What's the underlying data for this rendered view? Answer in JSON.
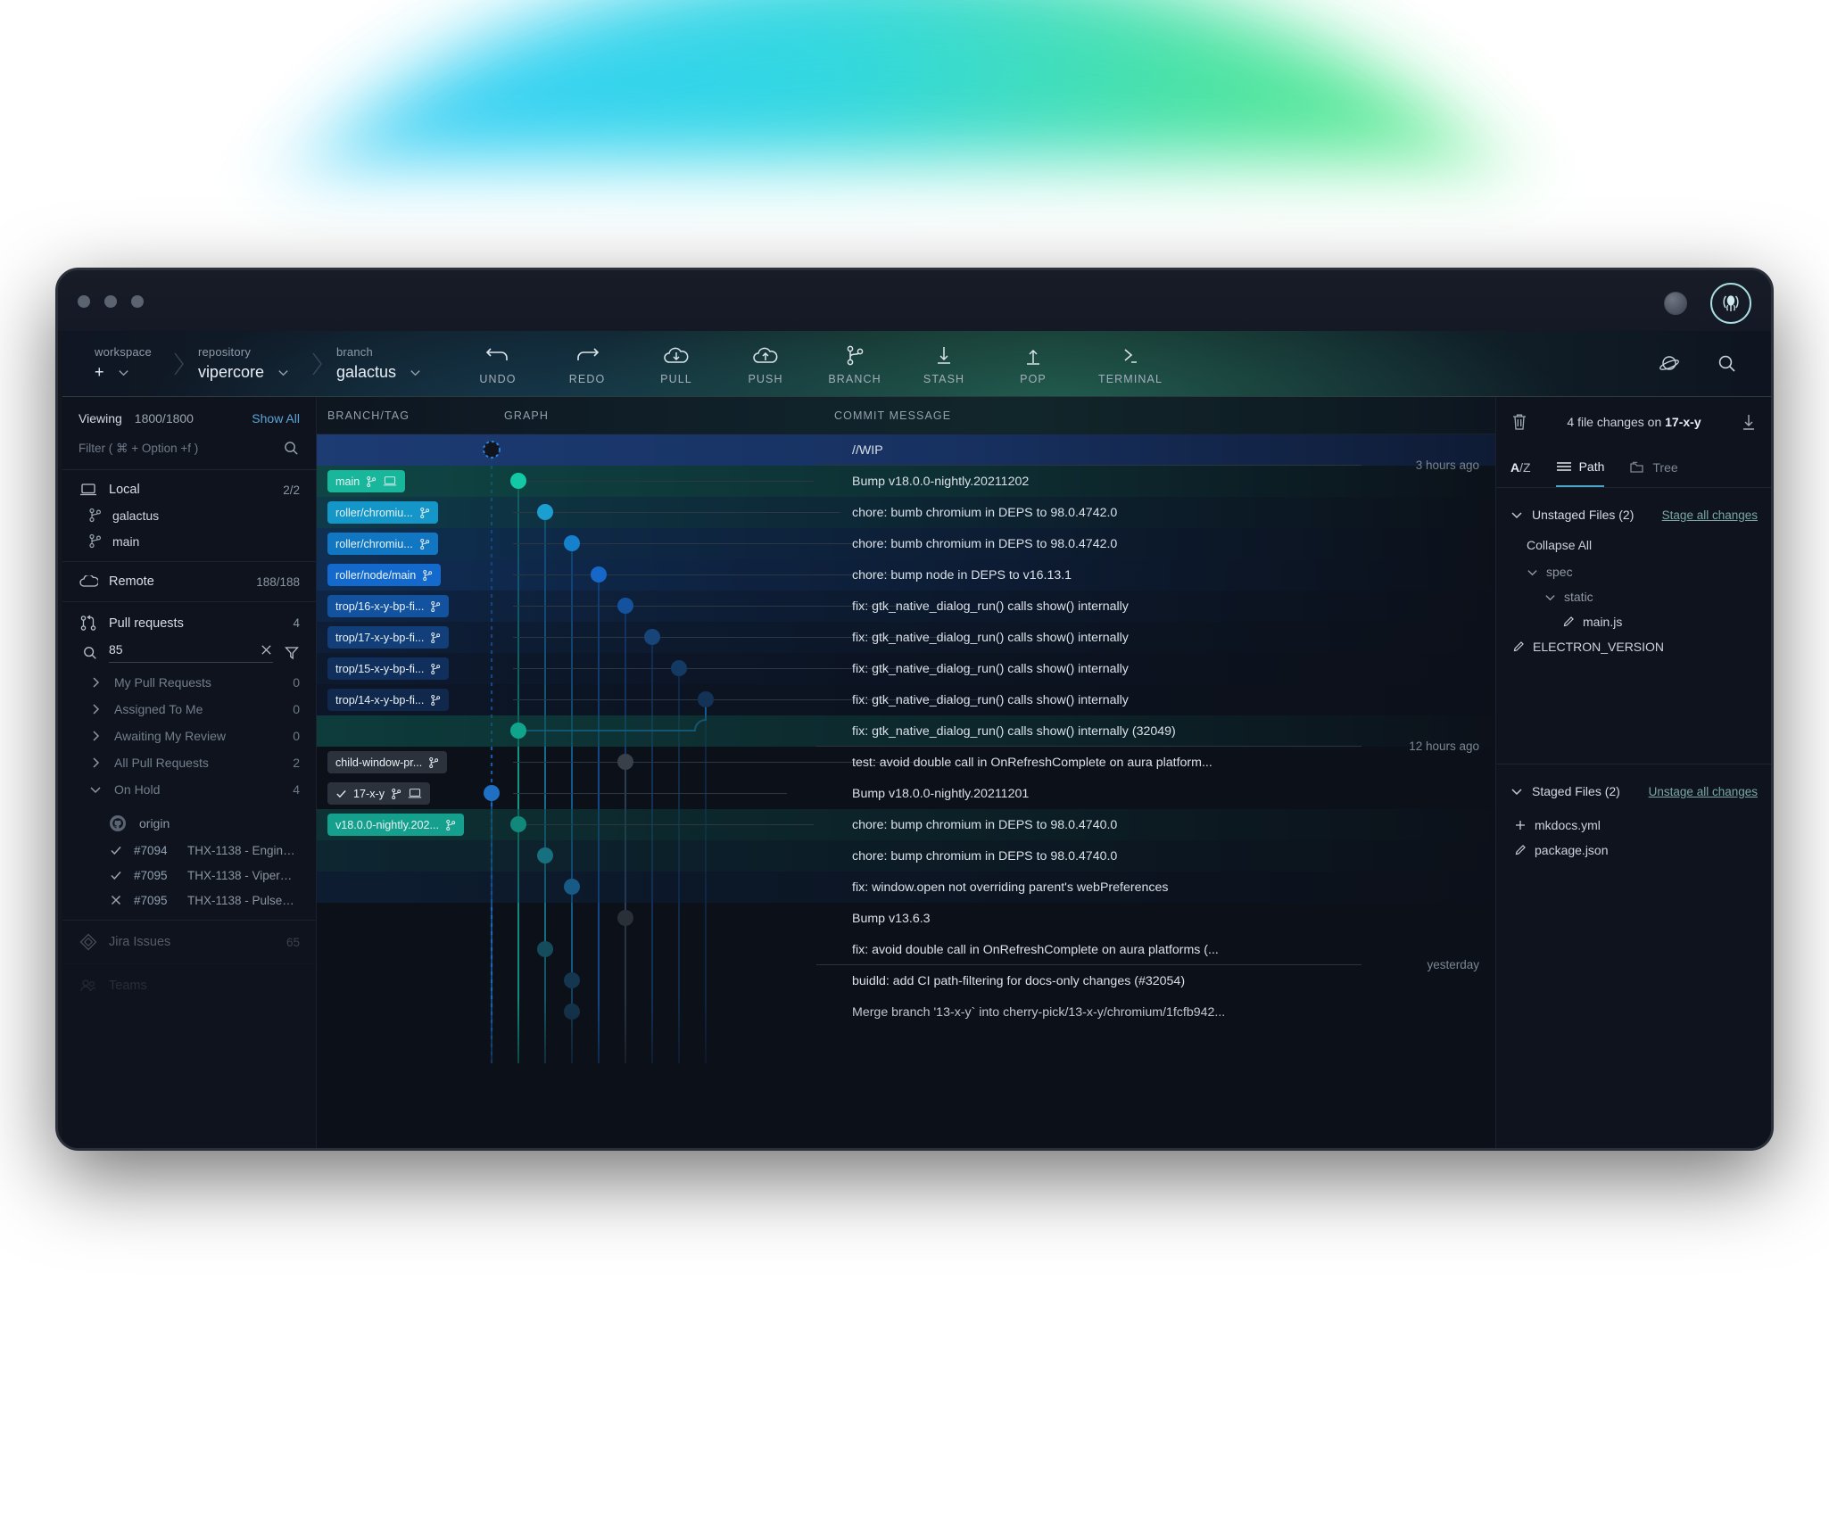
{
  "window": {
    "traffic_lights": [
      "close",
      "minimize",
      "maximize"
    ],
    "logo": "gitkraken-squid-logo"
  },
  "toolbar": {
    "crumbs": [
      {
        "label": "workspace",
        "value": "+",
        "name": "workspace"
      },
      {
        "label": "repository",
        "value": "vipercore",
        "name": "repository"
      },
      {
        "label": "branch",
        "value": "galactus",
        "name": "branch"
      }
    ],
    "actions": [
      {
        "icon": "undo-icon",
        "label": "UNDO"
      },
      {
        "icon": "redo-icon",
        "label": "REDO"
      },
      {
        "icon": "pull-cloud-icon",
        "label": "PULL"
      },
      {
        "icon": "push-cloud-icon",
        "label": "PUSH"
      },
      {
        "icon": "branch-icon",
        "label": "BRANCH"
      },
      {
        "icon": "stash-down-icon",
        "label": "STASH"
      },
      {
        "icon": "pop-up-icon",
        "label": "POP"
      },
      {
        "icon": "terminal-icon",
        "label": "TERMINAL"
      }
    ],
    "right_icons": [
      {
        "icon": "planet-icon",
        "name": "cloud-patches-button"
      },
      {
        "icon": "search-icon",
        "name": "global-search-button"
      }
    ]
  },
  "sidebar": {
    "viewing_label": "Viewing",
    "viewing_count": "1800/1800",
    "show_all": "Show All",
    "filter_placeholder": "Filter ( ⌘ + Option +f )",
    "local": {
      "label": "Local",
      "count": "2/2",
      "icon": "laptop-icon",
      "branches": [
        {
          "name": "galactus",
          "icon": "branch-icon"
        },
        {
          "name": "main",
          "icon": "branch-icon"
        }
      ]
    },
    "remote": {
      "label": "Remote",
      "count": "188/188",
      "icon": "cloud-icon"
    },
    "pull_requests": {
      "label": "Pull requests",
      "count": "4",
      "icon": "pull-request-icon",
      "search_value": "85",
      "filters": [
        {
          "label": "My Pull Requests",
          "count": "0",
          "expanded": false
        },
        {
          "label": "Assigned To Me",
          "count": "0",
          "expanded": false
        },
        {
          "label": "Awaiting My Review",
          "count": "0",
          "expanded": false
        },
        {
          "label": "All Pull Requests",
          "count": "2",
          "expanded": false
        },
        {
          "label": "On Hold",
          "count": "4",
          "expanded": true
        }
      ],
      "origin_label": "origin",
      "items": [
        {
          "status": "check",
          "number": "#7094",
          "title": "THX-1138 - Engine Mo.."
        },
        {
          "status": "check",
          "number": "#7095",
          "title": "THX-1138 - ViperCore"
        },
        {
          "status": "cross",
          "number": "#7095",
          "title": "THX-1138 - Pulsechar.."
        }
      ]
    },
    "jira": {
      "label": "Jira Issues",
      "count": "65",
      "icon": "jira-icon"
    },
    "teams": {
      "label": "Teams",
      "icon": "teams-icon"
    }
  },
  "graph": {
    "columns": {
      "branch_tag": "BRANCH/TAG",
      "graph": "GRAPH",
      "commit_message": "COMMIT MESSAGE"
    },
    "rows": [
      {
        "message": "//WIP",
        "tags": [],
        "node": {
          "lane": 0,
          "color": "#10141d",
          "dashed": true
        },
        "highlight": "wip",
        "time": "",
        "sep_after": true,
        "time_after": "3 hours ago"
      },
      {
        "message": "Bump v18.0.0-nightly.20211202",
        "tags": [
          {
            "text": "main",
            "color": "#18b79c",
            "icons": [
              "branch-icon",
              "laptop-icon"
            ]
          }
        ],
        "node": {
          "lane": 1,
          "color": "#13c8a4"
        },
        "highlight": "teal"
      },
      {
        "message": "chore: bumb chromium in DEPS to 98.0.4742.0",
        "tags": [
          {
            "text": "roller/chromiu...",
            "color": "#1497c8",
            "icons": [
              "branch-icon"
            ]
          }
        ],
        "node": {
          "lane": 2,
          "color": "#1b9ed0"
        },
        "highlight": "teal2"
      },
      {
        "message": "chore: bumb chromium in DEPS to 98.0.4742.0",
        "tags": [
          {
            "text": "roller/chromiu...",
            "color": "#1277c3",
            "icons": [
              "branch-icon"
            ]
          }
        ],
        "node": {
          "lane": 3,
          "color": "#1580cc"
        },
        "highlight": "blue1"
      },
      {
        "message": "chore: bump node in DEPS to v16.13.1",
        "tags": [
          {
            "text": "roller/node/main",
            "color": "#1469cd",
            "icons": [
              "branch-icon"
            ]
          }
        ],
        "node": {
          "lane": 4,
          "color": "#1667c7"
        },
        "highlight": "blue2"
      },
      {
        "message": "fix: gtk_native_dialog_run() calls show() internally",
        "tags": [
          {
            "text": "trop/16-x-y-bp-fi...",
            "color": "#13529f",
            "icons": [
              "branch-icon"
            ]
          }
        ],
        "node": {
          "lane": 5,
          "color": "#15529d"
        },
        "highlight": "blue3"
      },
      {
        "message": "fix: gtk_native_dialog_run() calls show() internally",
        "tags": [
          {
            "text": "trop/17-x-y-bp-fi...",
            "color": "#123f79",
            "icons": [
              "branch-icon"
            ]
          }
        ],
        "node": {
          "lane": 6,
          "color": "#174479"
        },
        "highlight": "blue4"
      },
      {
        "message": "fix: gtk_native_dialog_run() calls show() internally",
        "tags": [
          {
            "text": "trop/15-x-y-bp-fi...",
            "color": "#112f5d",
            "icons": [
              "branch-icon"
            ]
          }
        ],
        "node": {
          "lane": 7,
          "color": "#123a63"
        },
        "highlight": "blue5"
      },
      {
        "message": "fix: gtk_native_dialog_run() calls show() internally",
        "tags": [
          {
            "text": "trop/14-x-y-bp-fi...",
            "color": "#10284c",
            "icons": [
              "branch-icon"
            ]
          }
        ],
        "node": {
          "lane": 8,
          "color": "#143256"
        },
        "highlight": "blue6"
      },
      {
        "message": "fix: gtk_native_dialog_run() calls show() internally (32049)",
        "tags": [],
        "node": {
          "lane": 1,
          "color": "#11a48d"
        },
        "highlight": "teal3",
        "sep_after": true,
        "time_after": "12 hours ago"
      },
      {
        "message": "test: avoid double call in OnRefreshComplete on aura platform...",
        "tags": [
          {
            "text": "child-window-pr...",
            "color": "#2b323c",
            "icons": [
              "branch-icon"
            ]
          }
        ],
        "node": {
          "lane": 5,
          "color": "#3a4049"
        },
        "highlight": "none"
      },
      {
        "message": "Bump v18.0.0-nightly.20211201",
        "tags": [
          {
            "text": "17-x-y",
            "color": "#2b323c",
            "icons": [
              "check-icon",
              "branch-icon",
              "laptop-icon"
            ]
          }
        ],
        "node": {
          "lane": 0,
          "color": "#1f6fc2"
        },
        "highlight": "none"
      },
      {
        "message": "chore: bump chromium in DEPS to 98.0.4740.0",
        "tags": [
          {
            "text": "v18.0.0-nightly.202...",
            "color": "#14a08c",
            "icons": [
              "branch-icon"
            ]
          }
        ],
        "node": {
          "lane": 1,
          "color": "#12887a"
        },
        "highlight": "teal4"
      },
      {
        "message": "chore: bump chromium in DEPS to 98.0.4740.0",
        "tags": [],
        "node": {
          "lane": 2,
          "color": "#17707f"
        },
        "highlight": "teal5"
      },
      {
        "message": "fix: window.open not overriding parent's webPreferences",
        "tags": [],
        "node": {
          "lane": 3,
          "color": "#175a86"
        },
        "highlight": "blue7"
      },
      {
        "message": "Bump v13.6.3",
        "tags": [],
        "node": {
          "lane": 5,
          "color": "#2a3038"
        },
        "highlight": "none"
      },
      {
        "message": "fix: avoid double call in OnRefreshComplete on aura platforms (...",
        "tags": [],
        "node": {
          "lane": 2,
          "color": "#144c5c"
        },
        "highlight": "none",
        "sep_after": true,
        "time_after": "yesterday"
      },
      {
        "message": "buidld: add CI path-filtering for docs-only changes (#32054)",
        "tags": [],
        "node": {
          "lane": 3,
          "color": "#14364f"
        },
        "highlight": "none"
      },
      {
        "message": "Merge branch '13-x-y` into cherry-pick/13-x-y/chromium/1fcfb942...",
        "tags": [],
        "node": {
          "lane": 3,
          "color": "#14364f"
        },
        "highlight": "none"
      }
    ]
  },
  "right_panel": {
    "trash_icon": "trash-icon",
    "download_icon": "download-icon",
    "title_prefix": "4 file changes on ",
    "title_branch": "17-x-y",
    "tabs": [
      {
        "label": "A/Z",
        "icon": "sort-az-icon",
        "active": false
      },
      {
        "label": "Path",
        "icon": "list-icon",
        "active": true
      },
      {
        "label": "Tree",
        "icon": "folder-icon",
        "active": false
      }
    ],
    "unstaged": {
      "label": "Unstaged Files (2)",
      "action": "Stage all changes",
      "collapse_all": "Collapse All",
      "tree": [
        {
          "kind": "folder",
          "name": "spec",
          "depth": 0
        },
        {
          "kind": "folder",
          "name": "static",
          "depth": 1
        },
        {
          "kind": "file",
          "name": "main.js",
          "depth": 2,
          "status": "modified"
        },
        {
          "kind": "file",
          "name": "ELECTRON_VERSION",
          "depth": 0,
          "status": "modified"
        }
      ]
    },
    "staged": {
      "label": "Staged Files (2)",
      "action": "Unstage all changes",
      "files": [
        {
          "name": "mkdocs.yml",
          "status": "added"
        },
        {
          "name": "package.json",
          "status": "modified"
        }
      ]
    }
  }
}
